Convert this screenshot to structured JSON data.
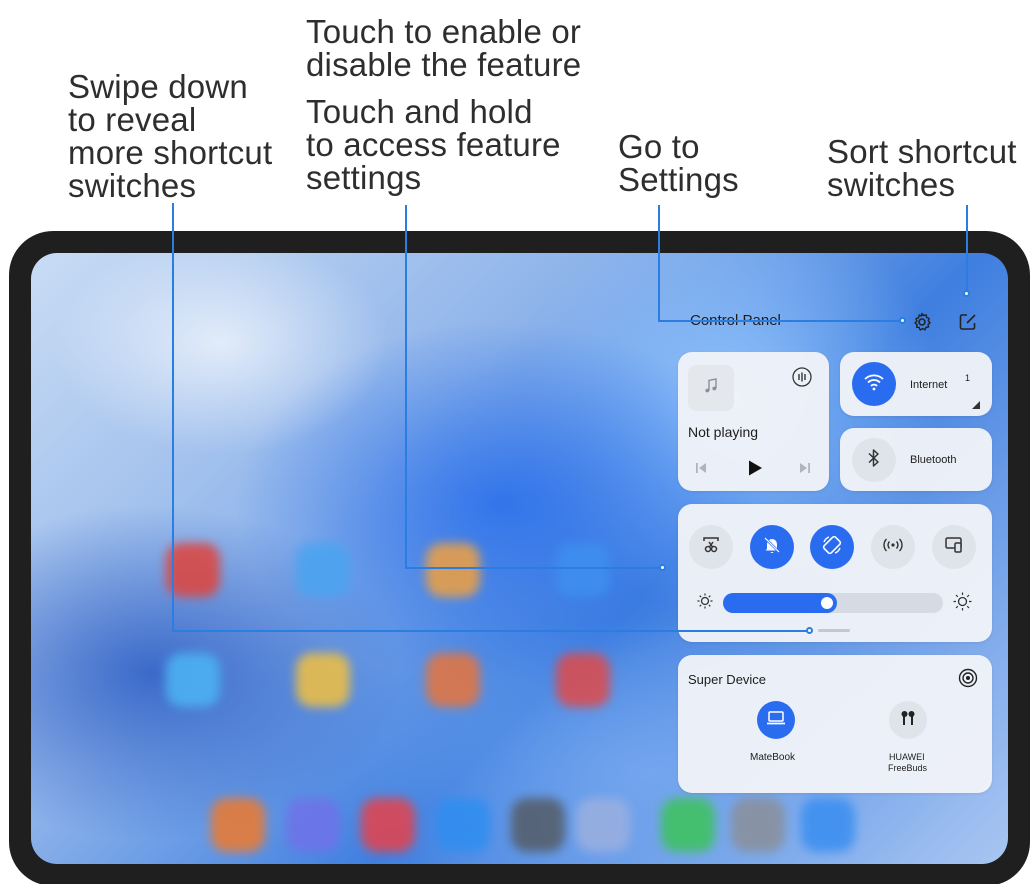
{
  "callouts": {
    "swipe": [
      "Swipe down",
      "to reveal",
      "more shortcut",
      "switches"
    ],
    "touch": [
      "Touch to enable or",
      "disable the feature"
    ],
    "hold": [
      "Touch and hold",
      "to access feature",
      "settings"
    ],
    "settings": [
      "Go to",
      "Settings"
    ],
    "sort": [
      "Sort shortcut",
      "switches"
    ]
  },
  "panel": {
    "title": "Control Panel",
    "header_icons": [
      "gear-icon",
      "edit-icon"
    ]
  },
  "media": {
    "status": "Not playing",
    "icons": [
      "music-note-icon",
      "audio-output-icon",
      "previous-icon",
      "play-icon",
      "next-icon"
    ]
  },
  "connectivity": [
    {
      "label": "Internet",
      "icon": "wifi-icon",
      "state": "on",
      "signal": "1"
    },
    {
      "label": "Bluetooth",
      "icon": "bluetooth-icon",
      "state": "off"
    }
  ],
  "shortcuts": [
    {
      "icon": "screenshot-icon",
      "state": "off"
    },
    {
      "icon": "silent-icon",
      "state": "on"
    },
    {
      "icon": "auto-rotate-icon",
      "state": "on"
    },
    {
      "icon": "hotspot-icon",
      "state": "off"
    },
    {
      "icon": "multi-screen-icon",
      "state": "off"
    }
  ],
  "brightness": {
    "level": 0.52,
    "icons": [
      "brightness-low-icon",
      "brightness-high-icon"
    ]
  },
  "super_device": {
    "title": "Super Device",
    "devices": [
      {
        "name": "MateBook",
        "icon": "laptop-icon",
        "state": "on"
      },
      {
        "name_line1": "HUAWEI",
        "name_line2": "FreeBuds",
        "icon": "earbuds-icon",
        "state": "off"
      }
    ]
  },
  "colors": {
    "accent": "#2a6cf0",
    "leader": "#2a7de1",
    "text": "#2e2e2e"
  }
}
